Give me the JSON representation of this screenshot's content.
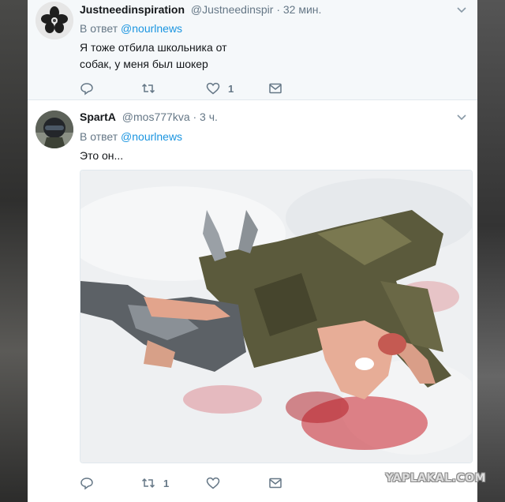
{
  "tweets": [
    {
      "name": "Justneedinspiration",
      "handle": "@Justneedinspir",
      "time": "· 32 мин.",
      "reply_prefix": "В ответ",
      "reply_handle": "@nourlnews",
      "text_line1": "Я тоже отбила школьника от",
      "text_line2": "собак, у меня был шокер",
      "like_count": "1",
      "retweet_count": ""
    },
    {
      "name": "SpartA",
      "handle": "@mos777kva",
      "time": "· 3 ч.",
      "reply_prefix": "В ответ",
      "reply_handle": "@nourlnews",
      "text_line1": "Это он...",
      "retweet_count": "1",
      "like_count": ""
    }
  ],
  "watermark": "YAPLAKAL.COM",
  "colors": {
    "accent": "#1b95e0",
    "secondary_text": "#657786",
    "primary_text": "#14171a",
    "tweet_bg_hover": "#f5f8fa"
  }
}
